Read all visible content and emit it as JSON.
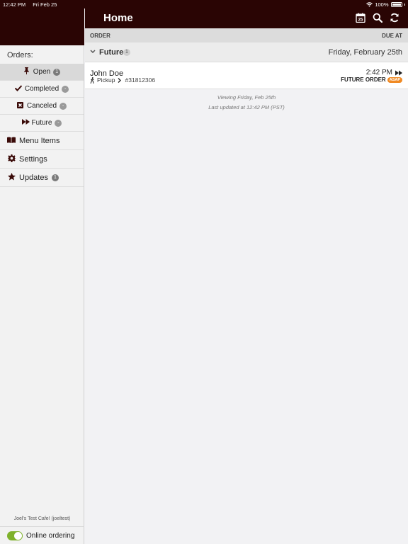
{
  "status_bar": {
    "time": "12:42 PM",
    "date": "Fri Feb 25",
    "battery": "100%"
  },
  "header": {
    "title": "Home",
    "calendar_day": "25"
  },
  "sidebar": {
    "orders_heading": "Orders:",
    "order_items": [
      {
        "label": "Open",
        "badge": "1",
        "icon": "pin-icon",
        "active": true
      },
      {
        "label": "Completed",
        "badge": "-",
        "icon": "checkmark-icon"
      },
      {
        "label": "Canceled",
        "badge": "-",
        "icon": "cancel-box-icon"
      },
      {
        "label": "Future",
        "badge": "-",
        "icon": "fast-forward-icon"
      }
    ],
    "main_items": [
      {
        "label": "Menu Items",
        "icon": "book-icon"
      },
      {
        "label": "Settings",
        "icon": "gear-icon"
      },
      {
        "label": "Updates",
        "badge": "1",
        "icon": "star-icon"
      }
    ],
    "cafe_name": "Joel's Test Cafe! (joeltest)",
    "online_label": "Online ordering",
    "online_enabled": true
  },
  "table": {
    "col_order": "ORDER",
    "col_due": "DUE AT"
  },
  "group": {
    "name": "Future",
    "count": "1",
    "date": "Friday, February 25th"
  },
  "order": {
    "customer": "John Doe",
    "method": "Pickup",
    "number": "#31812306",
    "due_time": "2:42 PM",
    "type": "FUTURE ORDER",
    "tag": "ASAP"
  },
  "footer": {
    "viewing": "Viewing Friday, Feb 25th",
    "updated": "Last updated at 12:42 PM (PST)"
  },
  "colors": {
    "brand": "#2a0504",
    "toggle": "#7fb22b",
    "asap": "#f08a24"
  }
}
